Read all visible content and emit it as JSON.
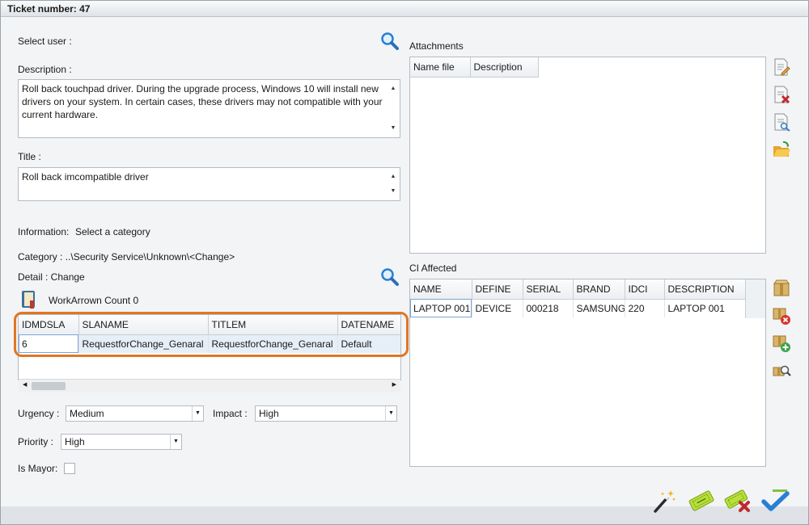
{
  "window": {
    "title": "Ticket number: 47"
  },
  "form": {
    "select_user_label": "Select user :",
    "description_label": "Description :",
    "description_value": "Roll back touchpad driver. During the upgrade process, Windows 10 will install new drivers on your system. In certain cases, these drivers may not compatible with your current hardware.",
    "title_label": "Title :",
    "title_value": "Roll back imcompatible driver",
    "information_label": "Information:",
    "information_value": "Select a category",
    "category_text": "Category : ..\\Security Service\\Unknown\\<Change>",
    "detail_text": "Detail : Change",
    "workarrow_text": "WorkArrown Count 0"
  },
  "sla_grid": {
    "columns": [
      "IDMDSLA",
      "SLANAME",
      "TITLEM",
      "DATENAME"
    ],
    "rows": [
      [
        "6",
        "RequestforChange_Genaral",
        "RequestforChange_Genaral",
        "Default"
      ]
    ]
  },
  "fields": {
    "urgency_label": "Urgency :",
    "urgency_value": "Medium",
    "impact_label": "Impact :",
    "impact_value": "High",
    "priority_label": "Priority :",
    "priority_value": "High",
    "is_mayor_label": "Is Mayor:"
  },
  "attachments": {
    "label": "Attachments",
    "columns": [
      "Name file",
      "Description"
    ]
  },
  "ci": {
    "label": "CI Affected",
    "columns": [
      "NAME",
      "DEFINE",
      "SERIAL",
      "BRAND",
      "IDCI",
      "DESCRIPTION"
    ],
    "rows": [
      [
        "LAPTOP 001",
        "DEVICE",
        "000218",
        "SAMSUNG",
        "220",
        "LAPTOP 001"
      ]
    ]
  },
  "icons": {
    "search": "search-icon",
    "book": "book-icon",
    "attach_edit": "edit-document-icon",
    "attach_delete": "delete-document-icon",
    "attach_view": "view-document-icon",
    "attach_open": "open-folder-icon",
    "ci_box": "package-icon",
    "ci_remove": "remove-package-icon",
    "ci_add": "add-package-icon",
    "ci_search": "search-package-icon",
    "wizard": "magic-wand-icon",
    "ticket": "ticket-icon",
    "ticket_cancel": "cancel-ticket-icon",
    "accept": "checkmark-icon"
  },
  "colors": {
    "highlight": "#e07626",
    "accent": "#2a7fd4"
  }
}
